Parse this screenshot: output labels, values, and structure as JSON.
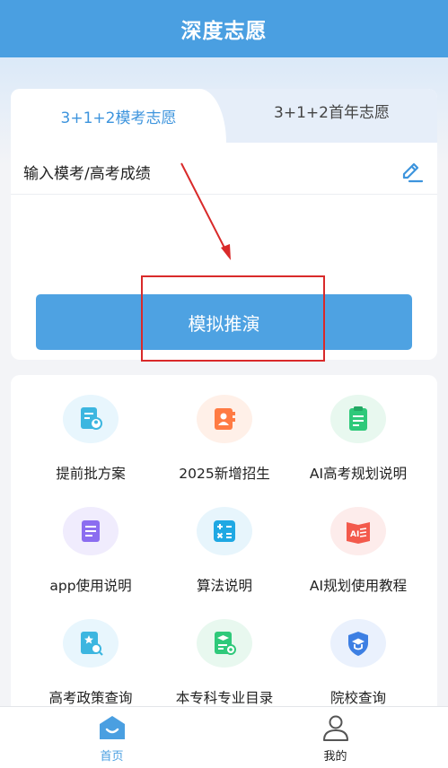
{
  "header": {
    "title": "深度志愿"
  },
  "tabs": [
    {
      "label": "3+1+2模考志愿",
      "active": true
    },
    {
      "label": "3+1+2首年志愿",
      "active": false
    }
  ],
  "score_input": {
    "prompt": "输入模考/高考成绩",
    "icon": "edit-icon"
  },
  "simulate_button": {
    "label": "模拟推演"
  },
  "grid": [
    {
      "label": "提前批方案",
      "icon": "doc-user-icon",
      "color": "#3cb6e0",
      "bg": "#e8f6fd"
    },
    {
      "label": "2025新增招生",
      "icon": "contact-card-icon",
      "color": "#ff7b43",
      "bg": "#fff0e8"
    },
    {
      "label": "AI高考规划说明",
      "icon": "exam-clipboard-icon",
      "color": "#2fc97a",
      "bg": "#e8f8ef"
    },
    {
      "label": "app使用说明",
      "icon": "document-icon",
      "color": "#8b6df0",
      "bg": "#f0ecfd"
    },
    {
      "label": "算法说明",
      "icon": "calculator-icon",
      "color": "#1fa8e3",
      "bg": "#e7f5fc"
    },
    {
      "label": "AI规划使用教程",
      "icon": "ai-book-icon",
      "color": "#f35a4c",
      "bg": "#fdeceb"
    },
    {
      "label": "高考政策查询",
      "icon": "policy-search-icon",
      "color": "#3cb6e0",
      "bg": "#e8f6fd"
    },
    {
      "label": "本专科专业目录",
      "icon": "graduation-catalog-icon",
      "color": "#2fc97a",
      "bg": "#e8f8ef"
    },
    {
      "label": "院校查询",
      "icon": "school-shield-icon",
      "color": "#3d7fe3",
      "bg": "#eaf1fd"
    }
  ],
  "tabbar": [
    {
      "label": "首页",
      "icon": "home-icon",
      "active": true,
      "color": "#4a9fe1"
    },
    {
      "label": "我的",
      "icon": "user-icon",
      "active": false,
      "color": "#555555"
    }
  ],
  "annotation": {
    "color": "#d92a2a"
  }
}
